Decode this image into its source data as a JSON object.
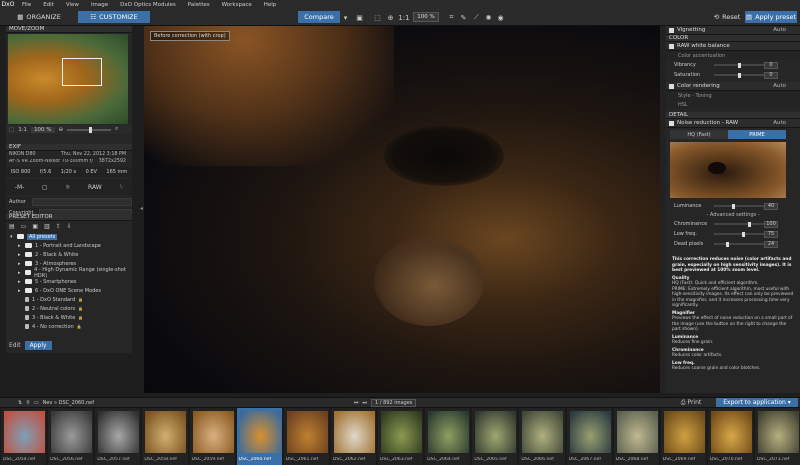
{
  "menubar": {
    "logo": "DxO",
    "items": [
      "File",
      "Edit",
      "View",
      "Image",
      "DxO Optics Modules",
      "Palettes",
      "Workspace",
      "Help"
    ]
  },
  "toolbar": {
    "organize": "ORGANIZE",
    "customize": "CUSTOMIZE",
    "compare": "Compare",
    "zoom_ratio": "1:1",
    "zoom_percent": "100 %",
    "reset": "Reset",
    "apply_preset": "Apply preset"
  },
  "move_zoom": {
    "title": "MOVE/ZOOM",
    "ratio": "1:1",
    "percent": "100 %"
  },
  "exif": {
    "title": "EXIF",
    "camera": "NIKON D80",
    "date": "Thu, Nov 22, 2012 3:18 PM",
    "lens": "AF-S VR Zoom-Nikkor 70-300mm f/4.5-5.6...",
    "dimensions": "3872x2592",
    "iso": "ISO 800",
    "aperture": "f/5.6",
    "shutter": "1/20 s",
    "ev": "0 EV",
    "focal": "165 mm",
    "mode": "-M-",
    "format": "RAW",
    "author_label": "Author",
    "copyright_label": "Copyright"
  },
  "preset_editor": {
    "title": "PRESET EDITOR",
    "items": [
      {
        "label": "All presets",
        "level": 0,
        "type": "folder",
        "selected": true
      },
      {
        "label": "1 - Portrait and Landscape",
        "level": 1,
        "type": "folder"
      },
      {
        "label": "2 - Black & White",
        "level": 1,
        "type": "folder"
      },
      {
        "label": "3 - Atmospheres",
        "level": 1,
        "type": "folder"
      },
      {
        "label": "4 - High Dynamic Range (single-shot HDR)",
        "level": 1,
        "type": "folder"
      },
      {
        "label": "5 - Smartphones",
        "level": 1,
        "type": "folder"
      },
      {
        "label": "6 - DxO ONE Scene Modes",
        "level": 1,
        "type": "folder"
      },
      {
        "label": "1 - DxO Standard",
        "level": 1,
        "type": "preset"
      },
      {
        "label": "2 - Neutral colors",
        "level": 1,
        "type": "preset"
      },
      {
        "label": "3 - Black & White",
        "level": 1,
        "type": "preset"
      },
      {
        "label": "4 - No correction",
        "level": 1,
        "type": "preset"
      }
    ],
    "edit": "Edit",
    "apply": "Apply"
  },
  "viewer": {
    "before_tag": "Before correction (with crop)"
  },
  "right": {
    "vignetting": "Vignetting",
    "auto": "Auto",
    "color_section": "COLOR",
    "raw_white_balance": "RAW white balance",
    "color_accentuation": "Color accentuation",
    "vibrancy_label": "Vibrancy",
    "vibrancy": "0",
    "saturation_label": "Saturation",
    "saturation": "0",
    "color_rendering": "Color rendering",
    "style_toning": "Style - Toning",
    "hsl": "HSL",
    "detail_section": "DETAIL",
    "noise_reduction": "Noise reduction - RAW",
    "tab_hq": "HQ (Fast)",
    "tab_prime": "PRIME",
    "luminance_label": "Luminance",
    "luminance": "40",
    "advanced": "- Advanced settings -",
    "chrominance_label": "Chrominance",
    "chrominance": "100",
    "lowfreq_label": "Low freq.",
    "lowfreq": "75",
    "deadpixels_label": "Dead pixels",
    "deadpixels": "24",
    "desc_lead": "This correction reduces noise (color artifacts and grain, especially on high sensitivity images). It is best previewed at 100% zoom level.",
    "quality_label": "Quality",
    "quality_hq": "HQ (Fast): Quick and efficient algorithm.",
    "quality_prime": "PRIME: Extremely efficient algorithm, most useful with high-sensitivity images. Its effect can only be previewed in the magnifier, and it increases processing time very significantly.",
    "magnifier_label": "Magnifier",
    "magnifier_text": "Previews the effect of noise reduction on a small part of the image (use the button on the right to change the part shown).",
    "luminance_desc_label": "Luminance",
    "luminance_desc": "Reduces fine grain.",
    "chrominance_desc_label": "Chrominance",
    "chrominance_desc": "Reduces color artifacts.",
    "lowfreq_desc_label": "Low freq.",
    "lowfreq_desc": "Reduces coarse grain and color blotches."
  },
  "filmbar": {
    "crumb": "Nev » DSC_2060.nef",
    "counter": "1 / 892 images",
    "print": "Print",
    "export": "Export to application"
  },
  "thumbnails": [
    {
      "name": "DSC_2054.nef",
      "c1": "#7fa0b8",
      "c2": "#c05040"
    },
    {
      "name": "DSC_2056.nef",
      "c1": "#9a9a9a",
      "c2": "#3a3a3a"
    },
    {
      "name": "DSC_2057.nef",
      "c1": "#a8a8a8",
      "c2": "#303030"
    },
    {
      "name": "DSC_2058.nef",
      "c1": "#d0b070",
      "c2": "#7a5020"
    },
    {
      "name": "DSC_2059.nef",
      "c1": "#d8b080",
      "c2": "#8a5a20"
    },
    {
      "name": "DSC_2060.nef",
      "c1": "#d89030",
      "c2": "#3a6a9a",
      "selected": true
    },
    {
      "name": "DSC_2061.nef",
      "c1": "#c08030",
      "c2": "#6a4020"
    },
    {
      "name": "DSC_2062.nef",
      "c1": "#e0d8c8",
      "c2": "#a07030"
    },
    {
      "name": "DSC_2063.nef",
      "c1": "#8a9a50",
      "c2": "#303a20"
    },
    {
      "name": "DSC_2064.nef",
      "c1": "#90a060",
      "c2": "#2a3a30"
    },
    {
      "name": "DSC_2065.nef",
      "c1": "#a0a870",
      "c2": "#303830"
    },
    {
      "name": "DSC_2066.nef",
      "c1": "#b0b080",
      "c2": "#404838"
    },
    {
      "name": "DSC_2067.nef",
      "c1": "#98a070",
      "c2": "#2a3a40"
    },
    {
      "name": "DSC_2068.nef",
      "c1": "#c0b890",
      "c2": "#5a6050"
    },
    {
      "name": "DSC_2069.nef",
      "c1": "#d0a040",
      "c2": "#6a4a1a"
    },
    {
      "name": "DSC_2070.nef",
      "c1": "#d8a848",
      "c2": "#704a18"
    },
    {
      "name": "DSC_2071.nef",
      "c1": "#b8b080",
      "c2": "#404030"
    }
  ]
}
